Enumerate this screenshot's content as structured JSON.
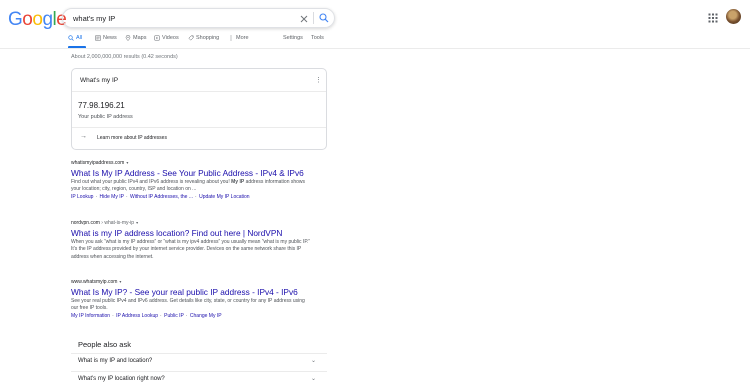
{
  "logo": {
    "text": "Google"
  },
  "search": {
    "query": "what's my IP",
    "placeholder": ""
  },
  "tabs": [
    {
      "label": "All",
      "icon": "search-icon"
    },
    {
      "label": "News",
      "icon": "news-icon"
    },
    {
      "label": "Maps",
      "icon": "map-pin-icon"
    },
    {
      "label": "Videos",
      "icon": "video-icon"
    },
    {
      "label": "Shopping",
      "icon": "tag-icon"
    },
    {
      "label": "More",
      "icon": "more-vert-icon"
    }
  ],
  "tools": {
    "settings": "Settings",
    "tools": "Tools"
  },
  "stats": "About 2,000,000,000 results (0.42 seconds)",
  "ip_card": {
    "title": "What's my IP",
    "ip": "77.98.196.21",
    "label": "Your public IP address",
    "learn_more": "Learn more about IP addresses"
  },
  "results": [
    {
      "url": "whatismyipaddress.com",
      "breadcrumb": "",
      "title": "What Is My IP Address - See Your Public Address - IPv4 & IPv6",
      "snippet_1": "Find out what your public IPv4 and IPv6 address is revealing about you!",
      "snippet_2": "My IP",
      "snippet_3": "address information shows your location; city, region, country, ISP and location on ...",
      "links": [
        "IP Lookup",
        "Hide My IP",
        "Without IP Addresses, the ...",
        "Update My IP Location"
      ]
    },
    {
      "url": "nordvpn.com",
      "breadcrumb": " › what-is-my-ip",
      "title": "What is my IP address location? Find out here | NordVPN",
      "snippet_1": "When you ask “what is my IP address” or “what is my ipv4 address” you usually mean “what is my public IP.” It’s the IP address provided by your internet service provider. Devices on the same network share this IP address when accessing the internet.",
      "snippet_2": "",
      "snippet_3": "",
      "links": []
    },
    {
      "url": "www.whatsmyip.com",
      "breadcrumb": "",
      "title": "What Is My IP? - See your real public IP address - IPv4 - IPv6",
      "snippet_1": "See your real public IPv4 and IPv6 address. Get details like city, state, or country for any IP address using our free IP tools.",
      "snippet_2": "",
      "snippet_3": "",
      "links": [
        "My IP Information",
        "IP Address Lookup",
        "Public IP",
        "Change My IP"
      ]
    }
  ],
  "paa": {
    "heading": "People also ask",
    "questions": [
      "What is my IP and location?",
      "What's my IP location right now?"
    ]
  },
  "colors": {
    "link": "#1a0dab",
    "accent": "#1a73e8",
    "text": "#202124",
    "muted": "#70757a"
  }
}
